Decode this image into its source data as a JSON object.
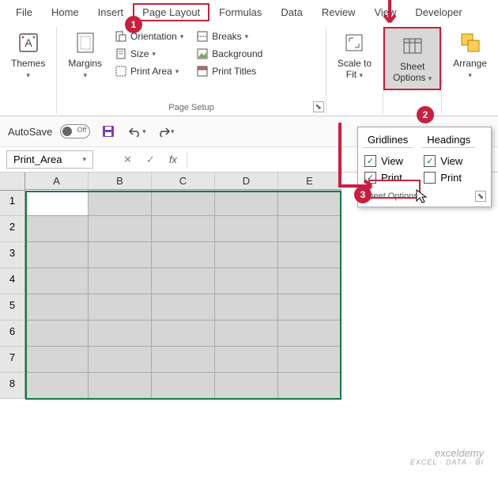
{
  "tabs": {
    "file": "File",
    "home": "Home",
    "insert": "Insert",
    "pagelayout": "Page Layout",
    "formulas": "Formulas",
    "data": "Data",
    "review": "Review",
    "view": "View",
    "developer": "Developer"
  },
  "ribbon": {
    "themes": {
      "label": "Themes"
    },
    "margins": {
      "label": "Margins"
    },
    "orientation": "Orientation",
    "size": "Size",
    "printarea": "Print Area",
    "breaks": "Breaks",
    "background": "Background",
    "printtitles": "Print Titles",
    "pagesetup_label": "Page Setup",
    "scaletofit": {
      "line1": "Scale to",
      "line2": "Fit"
    },
    "sheetoptions": {
      "line1": "Sheet",
      "line2": "Options"
    },
    "arrange": {
      "label": "Arrange"
    }
  },
  "autosave": {
    "label": "AutoSave",
    "state": "Off"
  },
  "namebox": {
    "value": "Print_Area"
  },
  "fx_label": "fx",
  "columns": [
    "A",
    "B",
    "C",
    "D",
    "E"
  ],
  "rows": [
    "1",
    "2",
    "3",
    "4",
    "5",
    "6",
    "7",
    "8"
  ],
  "popup": {
    "gridlines": "Gridlines",
    "headings": "Headings",
    "view": "View",
    "print": "Print",
    "footer": "Sheet Options"
  },
  "steps": {
    "s1": "1",
    "s2": "2",
    "s3": "3"
  },
  "watermark": {
    "main": "exceldemy",
    "sub": "EXCEL · DATA · BI"
  }
}
